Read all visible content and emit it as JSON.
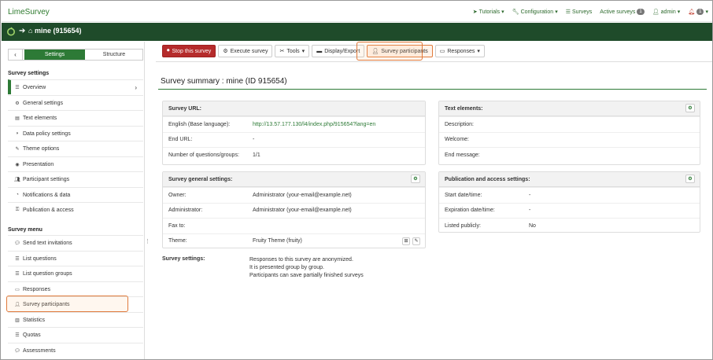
{
  "app": {
    "brand": "LimeSurvey"
  },
  "topnav": {
    "tutorials": "Tutorials",
    "configuration": "Configuration",
    "surveys": "Surveys",
    "active_surveys": "Active surveys",
    "active_count": "1",
    "admin": "admin",
    "notif_count": "1"
  },
  "header": {
    "title": "mine (915654)"
  },
  "sidebar": {
    "tabs": {
      "settings": "Settings",
      "structure": "Structure"
    },
    "section_settings": "Survey settings",
    "settings_items": [
      {
        "label": "Overview",
        "icon": "list-icon"
      },
      {
        "label": "General settings",
        "icon": "gears-icon"
      },
      {
        "label": "Text elements",
        "icon": "document-icon"
      },
      {
        "label": "Data policy settings",
        "icon": "shield-icon"
      },
      {
        "label": "Theme options",
        "icon": "brush-icon"
      },
      {
        "label": "Presentation",
        "icon": "eye-icon"
      },
      {
        "label": "Participant settings",
        "icon": "users-icon"
      },
      {
        "label": "Notifications & data",
        "icon": "feed-icon"
      },
      {
        "label": "Publication & access",
        "icon": "key-icon"
      }
    ],
    "section_menu": "Survey menu",
    "menu_items": [
      {
        "label": "Send text invitations",
        "icon": "comment-icon"
      },
      {
        "label": "List questions",
        "icon": "list-icon"
      },
      {
        "label": "List question groups",
        "icon": "list-icon"
      },
      {
        "label": "Responses",
        "icon": "comment-o-icon"
      },
      {
        "label": "Survey participants",
        "icon": "user-icon"
      },
      {
        "label": "Statistics",
        "icon": "bar-chart-icon"
      },
      {
        "label": "Quotas",
        "icon": "tasks-icon"
      },
      {
        "label": "Assessments",
        "icon": "comment-icon"
      }
    ]
  },
  "toolbar": {
    "stop": "Stop this survey",
    "execute": "Execute survey",
    "tools": "Tools",
    "display_export": "Display/Export",
    "participants": "Survey participants",
    "responses": "Responses"
  },
  "main": {
    "title": "Survey summary : mine (ID 915654)",
    "url_panel": {
      "title": "Survey URL:",
      "rows": [
        {
          "k": "English (Base language):",
          "v": "http://13.57.177.130/l4/index.php/915654?lang=en"
        },
        {
          "k": "End URL:",
          "v": "-"
        },
        {
          "k": "Number of questions/groups:",
          "v": "1/1"
        }
      ]
    },
    "general_panel": {
      "title": "Survey general settings:",
      "rows": [
        {
          "k": "Owner:",
          "v": "Administrator (your-email@example.net)"
        },
        {
          "k": "Administrator:",
          "v": "Administrator (your-email@example.net)"
        },
        {
          "k": "Fax to:",
          "v": ""
        },
        {
          "k": "Theme:",
          "v": "Fruity Theme (fruity)"
        }
      ]
    },
    "text_panel": {
      "title": "Text elements:",
      "rows": [
        {
          "k": "Description:",
          "v": ""
        },
        {
          "k": "Welcome:",
          "v": ""
        },
        {
          "k": "End message:",
          "v": ""
        }
      ]
    },
    "pub_panel": {
      "title": "Publication and access settings:",
      "rows": [
        {
          "k": "Start date/time:",
          "v": "-"
        },
        {
          "k": "Expiration date/time:",
          "v": "-"
        },
        {
          "k": "Listed publicly:",
          "v": "No"
        }
      ]
    },
    "survey_settings": {
      "label": "Survey settings:",
      "lines": [
        "Responses to this survey are anonymized.",
        "It is presented group by group.",
        "Participants can save partially finished surveys"
      ]
    }
  },
  "colors": {
    "brand": "#2d7a36",
    "header": "#1f4b2a",
    "danger": "#b52b2b",
    "highlight": "#e07a3c"
  }
}
